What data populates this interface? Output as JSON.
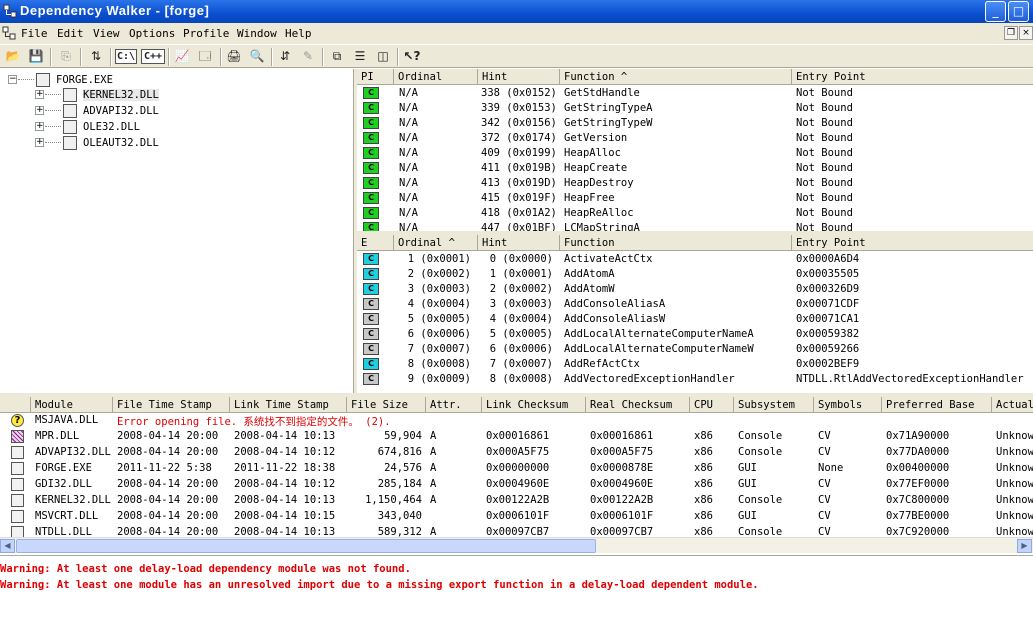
{
  "window": {
    "title": "Dependency Walker - [forge]"
  },
  "menu": [
    "File",
    "Edit",
    "View",
    "Options",
    "Profile",
    "Window",
    "Help"
  ],
  "toolbar": {
    "c_label": "C:\\",
    "cpp_label": "C++"
  },
  "tree": [
    {
      "label": "FORGE.EXE",
      "expander": "−"
    },
    {
      "label": "KERNEL32.DLL",
      "expander": "+"
    },
    {
      "label": "ADVAPI32.DLL",
      "expander": "+"
    },
    {
      "label": "OLE32.DLL",
      "expander": "+"
    },
    {
      "label": "OLEAUT32.DLL",
      "expander": "+"
    }
  ],
  "imports": {
    "headers": [
      "PI",
      "Ordinal",
      "Hint",
      "Function ^",
      "Entry Point"
    ],
    "rows": [
      {
        "icon": "C",
        "ordinal": "N/A",
        "hint": "338 (0x0152)",
        "function": "GetStdHandle",
        "entry": "Not Bound"
      },
      {
        "icon": "C",
        "ordinal": "N/A",
        "hint": "339 (0x0153)",
        "function": "GetStringTypeA",
        "entry": "Not Bound"
      },
      {
        "icon": "C",
        "ordinal": "N/A",
        "hint": "342 (0x0156)",
        "function": "GetStringTypeW",
        "entry": "Not Bound"
      },
      {
        "icon": "C",
        "ordinal": "N/A",
        "hint": "372 (0x0174)",
        "function": "GetVersion",
        "entry": "Not Bound"
      },
      {
        "icon": "C",
        "ordinal": "N/A",
        "hint": "409 (0x0199)",
        "function": "HeapAlloc",
        "entry": "Not Bound"
      },
      {
        "icon": "C",
        "ordinal": "N/A",
        "hint": "411 (0x019B)",
        "function": "HeapCreate",
        "entry": "Not Bound"
      },
      {
        "icon": "C",
        "ordinal": "N/A",
        "hint": "413 (0x019D)",
        "function": "HeapDestroy",
        "entry": "Not Bound"
      },
      {
        "icon": "C",
        "ordinal": "N/A",
        "hint": "415 (0x019F)",
        "function": "HeapFree",
        "entry": "Not Bound"
      },
      {
        "icon": "C",
        "ordinal": "N/A",
        "hint": "418 (0x01A2)",
        "function": "HeapReAlloc",
        "entry": "Not Bound"
      },
      {
        "icon": "C",
        "ordinal": "N/A",
        "hint": "447 (0x01BF)",
        "function": "LCMapStringA",
        "entry": "Not Bound"
      }
    ]
  },
  "exports": {
    "headers": [
      "E",
      "Ordinal ^",
      "Hint",
      "Function",
      "Entry Point"
    ],
    "rows": [
      {
        "icon": "C",
        "color": "cyan",
        "ordinal": "1 (0x0001)",
        "hint": "0 (0x0000)",
        "function": "ActivateActCtx",
        "entry": "0x0000A6D4"
      },
      {
        "icon": "C",
        "color": "cyan",
        "ordinal": "2 (0x0002)",
        "hint": "1 (0x0001)",
        "function": "AddAtomA",
        "entry": "0x00035505"
      },
      {
        "icon": "C",
        "color": "cyan",
        "ordinal": "3 (0x0003)",
        "hint": "2 (0x0002)",
        "function": "AddAtomW",
        "entry": "0x000326D9"
      },
      {
        "icon": "C",
        "color": "gray",
        "ordinal": "4 (0x0004)",
        "hint": "3 (0x0003)",
        "function": "AddConsoleAliasA",
        "entry": "0x00071CDF"
      },
      {
        "icon": "C",
        "color": "gray",
        "ordinal": "5 (0x0005)",
        "hint": "4 (0x0004)",
        "function": "AddConsoleAliasW",
        "entry": "0x00071CA1"
      },
      {
        "icon": "C",
        "color": "gray",
        "ordinal": "6 (0x0006)",
        "hint": "5 (0x0005)",
        "function": "AddLocalAlternateComputerNameA",
        "entry": "0x00059382"
      },
      {
        "icon": "C",
        "color": "gray",
        "ordinal": "7 (0x0007)",
        "hint": "6 (0x0006)",
        "function": "AddLocalAlternateComputerNameW",
        "entry": "0x00059266"
      },
      {
        "icon": "C",
        "color": "cyan",
        "ordinal": "8 (0x0008)",
        "hint": "7 (0x0007)",
        "function": "AddRefActCtx",
        "entry": "0x0002BEF9"
      },
      {
        "icon": "C",
        "color": "gray",
        "ordinal": "9 (0x0009)",
        "hint": "8 (0x0008)",
        "function": "AddVectoredExceptionHandler",
        "entry": "NTDLL.RtlAddVectoredExceptionHandler"
      }
    ]
  },
  "modules": {
    "headers": [
      "",
      "Module",
      "File Time Stamp",
      "Link Time Stamp",
      "File Size",
      "Attr.",
      "Link Checksum",
      "Real Checksum",
      "CPU",
      "Subsystem",
      "Symbols",
      "Preferred Base",
      "Actual"
    ],
    "error_row": {
      "module": "MSJAVA.DLL",
      "message": "Error opening file. 系统找不到指定的文件。 (2)."
    },
    "rows": [
      {
        "module": "MPR.DLL",
        "file_ts": "2008-04-14 20:00",
        "link_ts": "2008-04-14 10:13",
        "size": "59,904",
        "attr": "A",
        "link_ck": "0x00016861",
        "real_ck": "0x00016861",
        "cpu": "x86",
        "subsystem": "Console",
        "symbols": "CV",
        "base": "0x71A90000",
        "actual": "Unknown"
      },
      {
        "module": "ADVAPI32.DLL",
        "file_ts": "2008-04-14 20:00",
        "link_ts": "2008-04-14 10:12",
        "size": "674,816",
        "attr": "A",
        "link_ck": "0x000A5F75",
        "real_ck": "0x000A5F75",
        "cpu": "x86",
        "subsystem": "Console",
        "symbols": "CV",
        "base": "0x77DA0000",
        "actual": "Unknown"
      },
      {
        "module": "FORGE.EXE",
        "file_ts": "2011-11-22  5:38",
        "link_ts": "2011-11-22 18:38",
        "size": "24,576",
        "attr": "A",
        "link_ck": "0x00000000",
        "real_ck": "0x0000878E",
        "cpu": "x86",
        "subsystem": "GUI",
        "symbols": "None",
        "base": "0x00400000",
        "actual": "Unknown"
      },
      {
        "module": "GDI32.DLL",
        "file_ts": "2008-04-14 20:00",
        "link_ts": "2008-04-14 10:12",
        "size": "285,184",
        "attr": "A",
        "link_ck": "0x0004960E",
        "real_ck": "0x0004960E",
        "cpu": "x86",
        "subsystem": "GUI",
        "symbols": "CV",
        "base": "0x77EF0000",
        "actual": "Unknown"
      },
      {
        "module": "KERNEL32.DLL",
        "file_ts": "2008-04-14 20:00",
        "link_ts": "2008-04-14 10:13",
        "size": "1,150,464",
        "attr": "A",
        "link_ck": "0x00122A2B",
        "real_ck": "0x00122A2B",
        "cpu": "x86",
        "subsystem": "Console",
        "symbols": "CV",
        "base": "0x7C800000",
        "actual": "Unknown"
      },
      {
        "module": "MSVCRT.DLL",
        "file_ts": "2008-04-14 20:00",
        "link_ts": "2008-04-14 10:15",
        "size": "343,040",
        "attr": "",
        "link_ck": "0x0006101F",
        "real_ck": "0x0006101F",
        "cpu": "x86",
        "subsystem": "GUI",
        "symbols": "CV",
        "base": "0x77BE0000",
        "actual": "Unknown"
      },
      {
        "module": "NTDLL.DLL",
        "file_ts": "2008-04-14 20:00",
        "link_ts": "2008-04-14 10:13",
        "size": "589,312",
        "attr": "A",
        "link_ck": "0x00097CB7",
        "real_ck": "0x00097CB7",
        "cpu": "x86",
        "subsystem": "Console",
        "symbols": "CV",
        "base": "0x7C920000",
        "actual": "Unknown"
      }
    ]
  },
  "log": [
    "Warning: At least one delay-load dependency module was not found.",
    "Warning: At least one module has an unresolved import due to a missing export function in a delay-load dependent module."
  ]
}
